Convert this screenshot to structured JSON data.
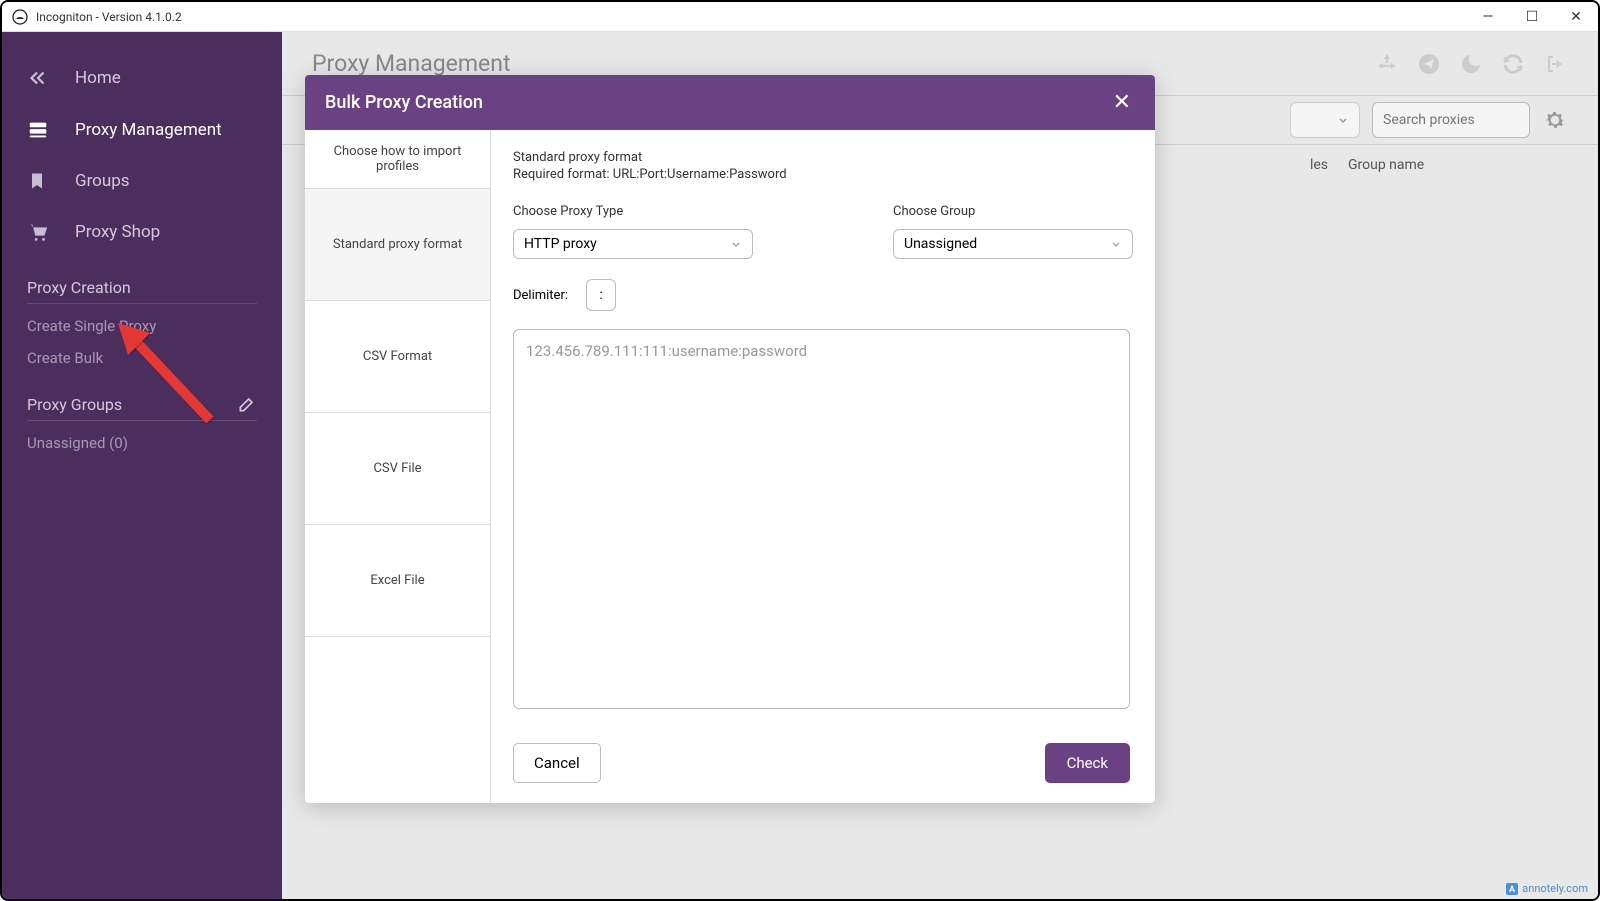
{
  "window": {
    "title": "Incogniton - Version 4.1.0.2"
  },
  "sidebar": {
    "items": [
      {
        "label": "Home"
      },
      {
        "label": "Proxy Management"
      },
      {
        "label": "Groups"
      },
      {
        "label": "Proxy Shop"
      }
    ],
    "sections": {
      "proxy_creation": {
        "title": "Proxy Creation",
        "items": [
          {
            "label": "Create Single Proxy"
          },
          {
            "label": "Create Bulk"
          }
        ]
      },
      "proxy_groups": {
        "title": "Proxy Groups",
        "items": [
          {
            "label": "Unassigned (0)"
          }
        ]
      }
    }
  },
  "main": {
    "title": "Proxy Management",
    "search_placeholder": "Search proxies",
    "columns": {
      "les": "les",
      "group_name": "Group name"
    }
  },
  "modal": {
    "title": "Bulk Proxy Creation",
    "tabs": {
      "header": "Choose how to import profiles",
      "standard": "Standard proxy format",
      "csv_format": "CSV Format",
      "csv_file": "CSV File",
      "excel_file": "Excel File"
    },
    "content": {
      "heading": "Standard proxy format",
      "required_format": "Required format: URL:Port:Username:Password",
      "proxy_type_label": "Choose Proxy Type",
      "proxy_type_value": "HTTP proxy",
      "group_label": "Choose Group",
      "group_value": "Unassigned",
      "delimiter_label": "Delimiter:",
      "delimiter_value": ":",
      "textarea_placeholder": "123.456.789.111:111:username:password",
      "cancel_label": "Cancel",
      "check_label": "Check"
    }
  },
  "watermark": "annotely.com"
}
